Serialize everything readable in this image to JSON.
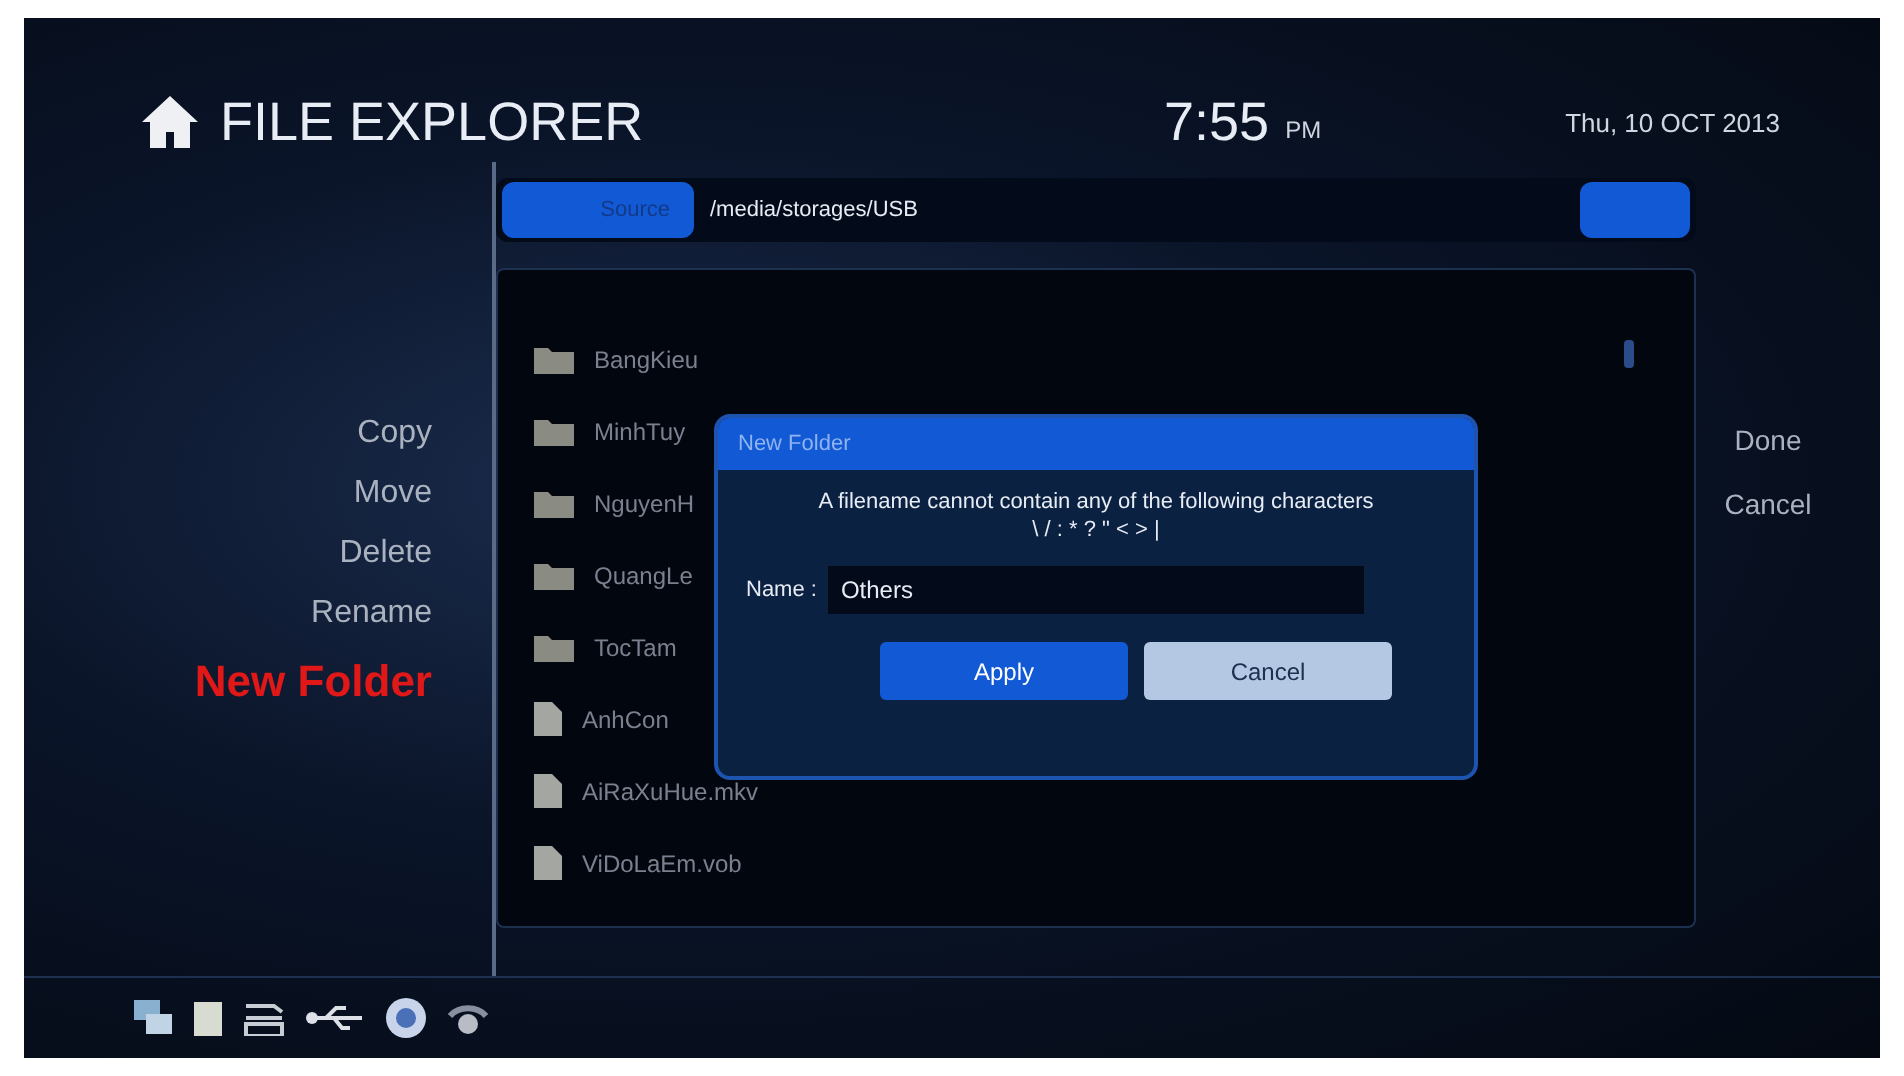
{
  "header": {
    "title": "FILE EXPLORER",
    "time": "7:55",
    "ampm": "PM",
    "date": "Thu, 10 OCT 2013"
  },
  "path_bar": {
    "source_label": "Source",
    "path": "/media/storages/USB"
  },
  "menu": [
    {
      "label": "Copy",
      "selected": false
    },
    {
      "label": "Move",
      "selected": false
    },
    {
      "label": "Delete",
      "selected": false
    },
    {
      "label": "Rename",
      "selected": false
    },
    {
      "label": "New Folder",
      "selected": true
    }
  ],
  "files": [
    {
      "name": "BangKieu",
      "kind": "folder"
    },
    {
      "name": "MinhTuy",
      "kind": "folder"
    },
    {
      "name": "NguyenH",
      "kind": "folder"
    },
    {
      "name": "QuangLe",
      "kind": "folder"
    },
    {
      "name": "TocTam",
      "kind": "folder"
    },
    {
      "name": "AnhCon",
      "kind": "file"
    },
    {
      "name": "AiRaXuHue.mkv",
      "kind": "file"
    },
    {
      "name": "ViDoLaEm.vob",
      "kind": "file"
    }
  ],
  "right_menu": [
    "Done",
    "Cancel"
  ],
  "dialog": {
    "title": "New Folder",
    "message": "A filename cannot contain any of the following characters",
    "characters": "\\ / : * ? \" < > |",
    "name_label": "Name :",
    "name_value": "Others",
    "buttons": [
      {
        "label": "Apply",
        "selected": true
      },
      {
        "label": "Cancel",
        "selected": false
      }
    ]
  }
}
